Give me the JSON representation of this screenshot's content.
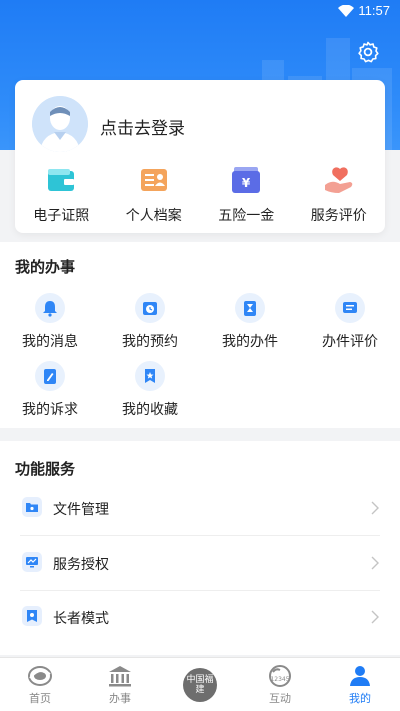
{
  "statusbar": {
    "time": "11:57"
  },
  "profile": {
    "login_text": "点击去登录"
  },
  "quick_items": [
    {
      "label": "电子证照",
      "icon": "card-wallet-icon"
    },
    {
      "label": "个人档案",
      "icon": "profile-file-icon"
    },
    {
      "label": "五险一金",
      "icon": "insurance-yen-icon"
    },
    {
      "label": "服务评价",
      "icon": "heart-hand-icon"
    }
  ],
  "my_affairs": {
    "title": "我的办事",
    "items": [
      {
        "label": "我的消息",
        "icon": "bell-icon"
      },
      {
        "label": "我的预约",
        "icon": "alarm-clock-icon"
      },
      {
        "label": "我的办件",
        "icon": "hourglass-doc-icon"
      },
      {
        "label": "办件评价",
        "icon": "comment-icon"
      },
      {
        "label": "我的诉求",
        "icon": "edit-doc-icon"
      },
      {
        "label": "我的收藏",
        "icon": "bookmark-star-icon"
      }
    ]
  },
  "functions": {
    "title": "功能服务",
    "items": [
      {
        "label": "文件管理",
        "icon": "folder-icon"
      },
      {
        "label": "服务授权",
        "icon": "monitor-chart-icon"
      },
      {
        "label": "长者模式",
        "icon": "elder-badge-icon"
      }
    ]
  },
  "tabbar": {
    "items": [
      {
        "label": "首页",
        "active": false
      },
      {
        "label": "办事",
        "active": false
      },
      {
        "label": "",
        "seal_text": "中国福建"
      },
      {
        "label": "互动",
        "active": false,
        "badge_text": "12345"
      },
      {
        "label": "我的",
        "active": true
      }
    ]
  },
  "colors": {
    "primary": "#1f7cf5",
    "icon_bg": "#e8f1fd"
  }
}
